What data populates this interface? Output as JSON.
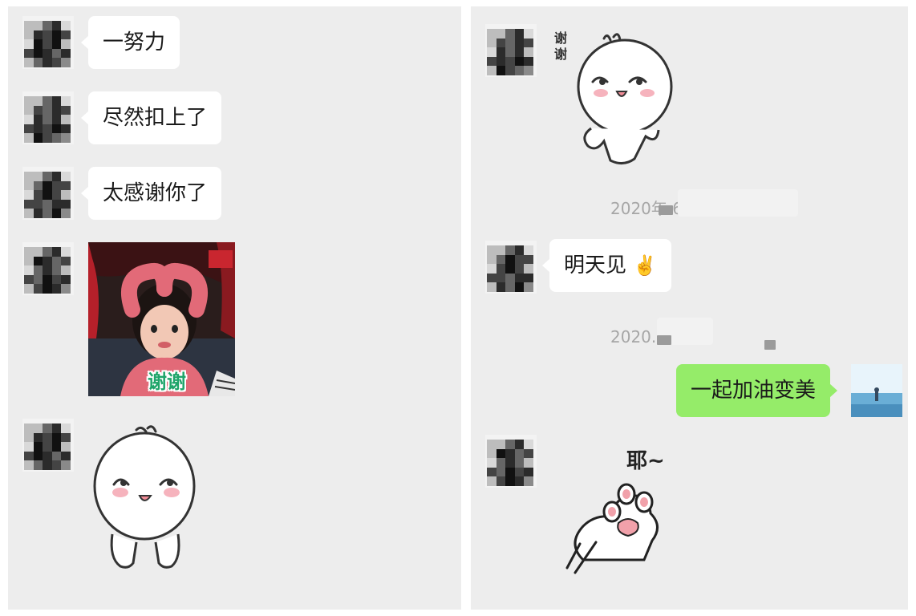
{
  "left_panel": {
    "messages": [
      {
        "sender": "other",
        "type": "text",
        "text": "一努力"
      },
      {
        "sender": "other",
        "type": "text",
        "text": "尽然扣上了"
      },
      {
        "sender": "other",
        "type": "text",
        "text": "太感谢你了"
      },
      {
        "sender": "other",
        "type": "image",
        "caption": "谢谢"
      },
      {
        "sender": "other",
        "type": "sticker",
        "icon": "blob-character-sticker"
      }
    ]
  },
  "right_panel": {
    "sticker_text": "谢谢",
    "timestamp_1": "2020年 6日 ",
    "message_1": "明天见",
    "message_1_emoji": "✌️",
    "timestamp_2": "2020. 日",
    "my_message": "一起加油变美",
    "paw_sticker_text": "耶~"
  },
  "colors": {
    "chat_background": "#ededed",
    "incoming_bubble": "#ffffff",
    "outgoing_bubble": "#95ec69",
    "timestamp_text": "#a6a6a6",
    "caption_green": "#1fa56a"
  }
}
